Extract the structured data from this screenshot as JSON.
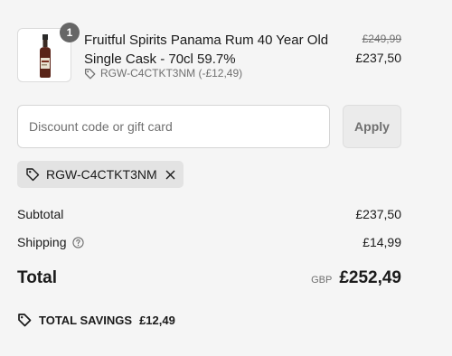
{
  "product": {
    "quantity": "1",
    "title": "Fruitful Spirits Panama Rum 40 Year Old Single Cask - 70cl 59.7%",
    "discount_line": "RGW-C4CTKT3NM (-£12,49)",
    "original_price": "£249,99",
    "price": "£237,50",
    "image_icon": "rum-bottle-icon"
  },
  "discount": {
    "placeholder": "Discount code or gift card",
    "value": "",
    "apply_label": "Apply",
    "applied_code": "RGW-C4CTKT3NM"
  },
  "summary": {
    "subtotal_label": "Subtotal",
    "subtotal_value": "£237,50",
    "shipping_label": "Shipping",
    "shipping_value": "£14,99",
    "total_label": "Total",
    "currency": "GBP",
    "total_value": "£252,49",
    "savings_label": "TOTAL SAVINGS",
    "savings_value": "£12,49"
  },
  "colors": {
    "background": "#f5f5f5",
    "text": "#1a1a1a",
    "muted": "#707070",
    "chip": "#e3e3e3",
    "badge": "#666666"
  }
}
